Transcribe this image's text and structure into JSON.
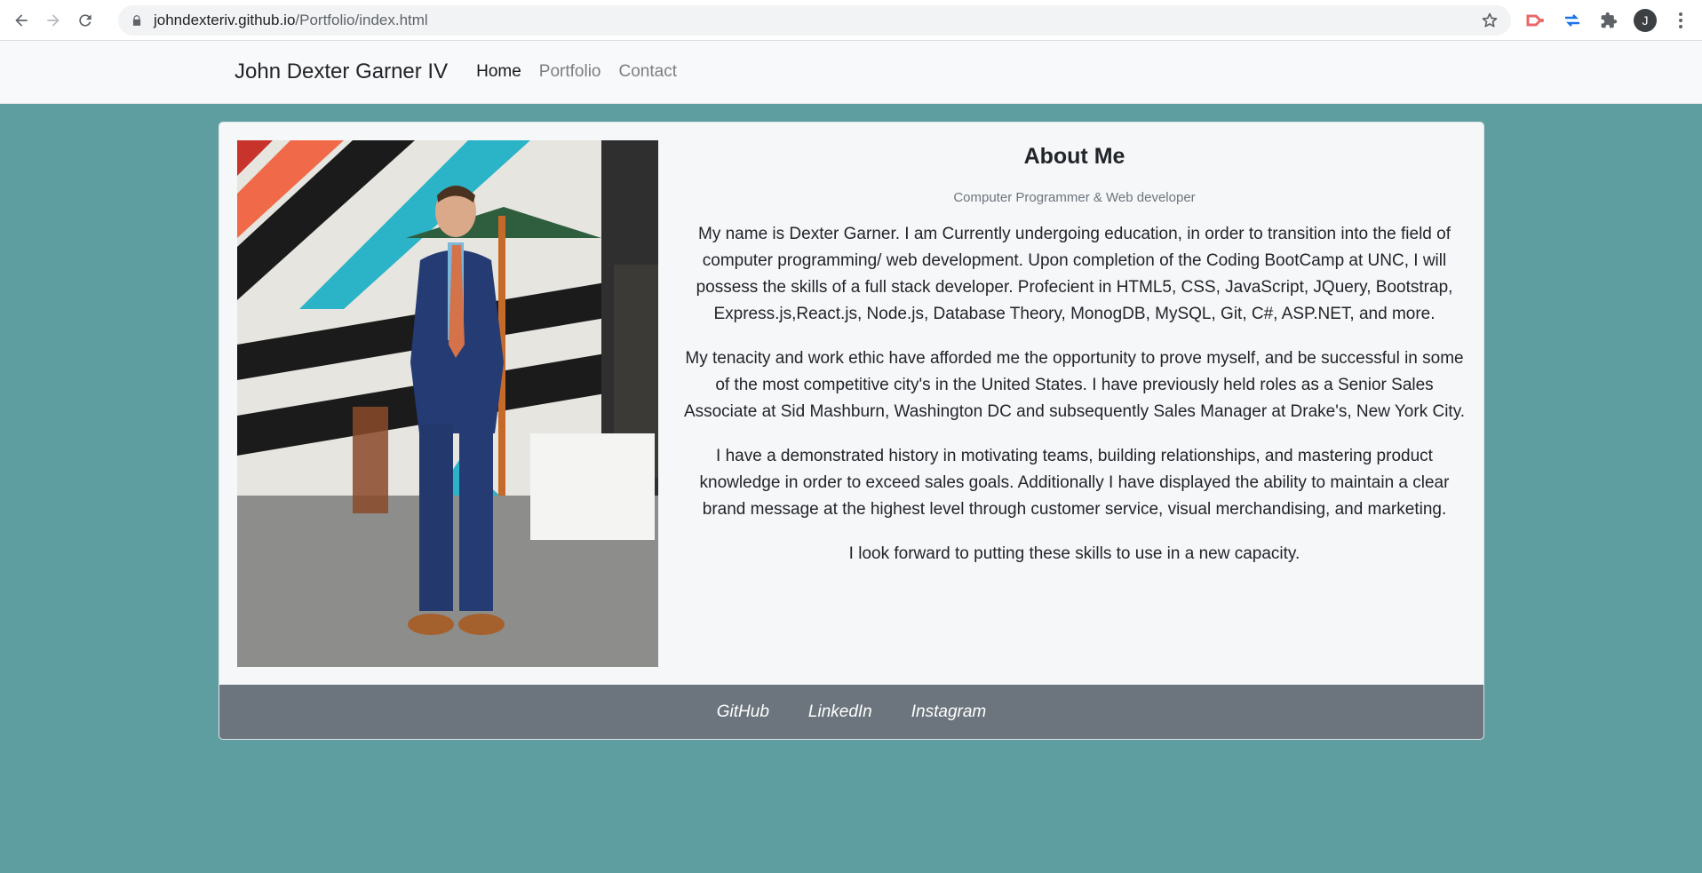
{
  "browser": {
    "url_host": "johndexteriv.github.io",
    "url_path": "/Portfolio/index.html",
    "profile_initial": "J"
  },
  "navbar": {
    "brand": "John Dexter Garner IV",
    "links": [
      {
        "label": "Home",
        "active": true
      },
      {
        "label": "Portfolio",
        "active": false
      },
      {
        "label": "Contact",
        "active": false
      }
    ]
  },
  "about": {
    "title": "About Me",
    "subtitle": "Computer Programmer & Web developer",
    "paragraphs": [
      "My name is Dexter Garner. I am Currently undergoing education, in order to transition into the field of computer programming/ web development. Upon completion of the Coding BootCamp at UNC, I will possess the skills of a full stack developer. Profecient in HTML5, CSS, JavaScript, JQuery, Bootstrap, Express.js,React.js, Node.js, Database Theory, MonogDB, MySQL, Git, C#, ASP.NET, and more.",
      "My tenacity and work ethic have afforded me the opportunity to prove myself, and be successful in some of the most competitive city's in the United States. I have previously held roles as a Senior Sales Associate at Sid Mashburn, Washington DC and subsequently Sales Manager at Drake's, New York City.",
      "I have a demonstrated history in motivating teams, building relationships, and mastering product knowledge in order to exceed sales goals. Additionally I have displayed the ability to maintain a clear brand message at the highest level through customer service, visual merchandising, and marketing.",
      "I look forward to putting these skills to use in a new capacity."
    ]
  },
  "footer": {
    "links": [
      "GitHub",
      "LinkedIn",
      "Instagram"
    ]
  },
  "colors": {
    "page_background": "#5f9ea0",
    "footer_background": "#6c757d",
    "navbar_background": "#f8f9fa"
  },
  "icons": [
    "back-arrow-icon",
    "forward-arrow-icon",
    "reload-icon",
    "lock-icon",
    "star-icon",
    "puzzle-icon",
    "menu-kebab-icon"
  ]
}
